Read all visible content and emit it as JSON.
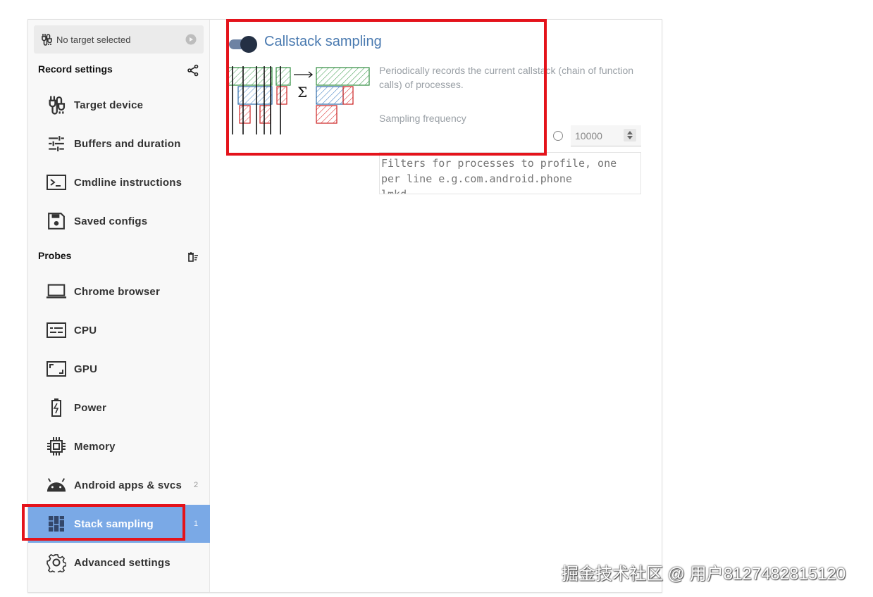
{
  "target": {
    "label": "No target selected"
  },
  "record_settings": {
    "title": "Record settings",
    "items": [
      {
        "label": "Target device",
        "icon": "cable-icon"
      },
      {
        "label": "Buffers and duration",
        "icon": "tune-icon"
      },
      {
        "label": "Cmdline instructions",
        "icon": "terminal-icon"
      },
      {
        "label": "Saved configs",
        "icon": "save-icon"
      }
    ]
  },
  "probes": {
    "title": "Probes",
    "items": [
      {
        "label": "Chrome browser",
        "icon": "laptop-icon",
        "badge": ""
      },
      {
        "label": "CPU",
        "icon": "cpu-chart-icon",
        "badge": ""
      },
      {
        "label": "GPU",
        "icon": "gpu-icon",
        "badge": ""
      },
      {
        "label": "Power",
        "icon": "battery-icon",
        "badge": ""
      },
      {
        "label": "Memory",
        "icon": "memory-chip-icon",
        "badge": ""
      },
      {
        "label": "Android apps & svcs",
        "icon": "android-icon",
        "badge": "2"
      },
      {
        "label": "Stack sampling",
        "icon": "stack-icon",
        "badge": "1",
        "active": true
      },
      {
        "label": "Advanced settings",
        "icon": "gear-icon",
        "badge": ""
      }
    ]
  },
  "probe": {
    "title": "Callstack sampling",
    "enabled": true,
    "description": "Periodically records the current callstack (chain of function calls) of processes.",
    "frequency_label": "Sampling frequency",
    "frequency_value": "10000",
    "filters_placeholder": "Filters for processes to profile, one per line e.g.com.android.phone\nlmkd"
  },
  "watermark": "掘金技术社区 @ 用户8127482815120",
  "colors": {
    "accent": "#4a7ab0",
    "active_bg": "#7aa9e6",
    "highlight": "#e4131b"
  }
}
